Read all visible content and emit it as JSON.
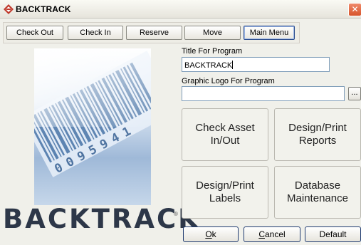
{
  "window": {
    "title": "BACKTRACK",
    "close_glyph": "✕"
  },
  "toolbar": {
    "buttons": [
      {
        "label": "Check Out"
      },
      {
        "label": "Check In"
      },
      {
        "label": "Reserve"
      },
      {
        "label": "Move"
      },
      {
        "label": "Main Menu",
        "active": true
      }
    ]
  },
  "brand": {
    "name": "BACKTRACK",
    "registered": "®"
  },
  "form": {
    "title_label": "Title For Program",
    "title_value": "BACKTRACK",
    "logo_label": "Graphic Logo For Program",
    "logo_value": "",
    "browse_label": "..."
  },
  "actions": {
    "check_asset": "Check Asset\nIn/Out",
    "design_reports": "Design/Print\nReports",
    "design_labels": "Design/Print\nLabels",
    "db_maintenance": "Database\nMaintenance"
  },
  "footer": {
    "ok_mnemonic": "O",
    "ok_rest": "k",
    "cancel_mnemonic": "C",
    "cancel_rest": "ancel",
    "default_label": "Default"
  },
  "icons": {
    "app": "backtrack-app-icon",
    "close": "close-icon",
    "barcode": "barcode-artwork"
  },
  "colors": {
    "close_red": "#d7542c",
    "brand_text": "#2d3748",
    "field_border": "#7f9db9",
    "button_border": "#1f3b70"
  }
}
